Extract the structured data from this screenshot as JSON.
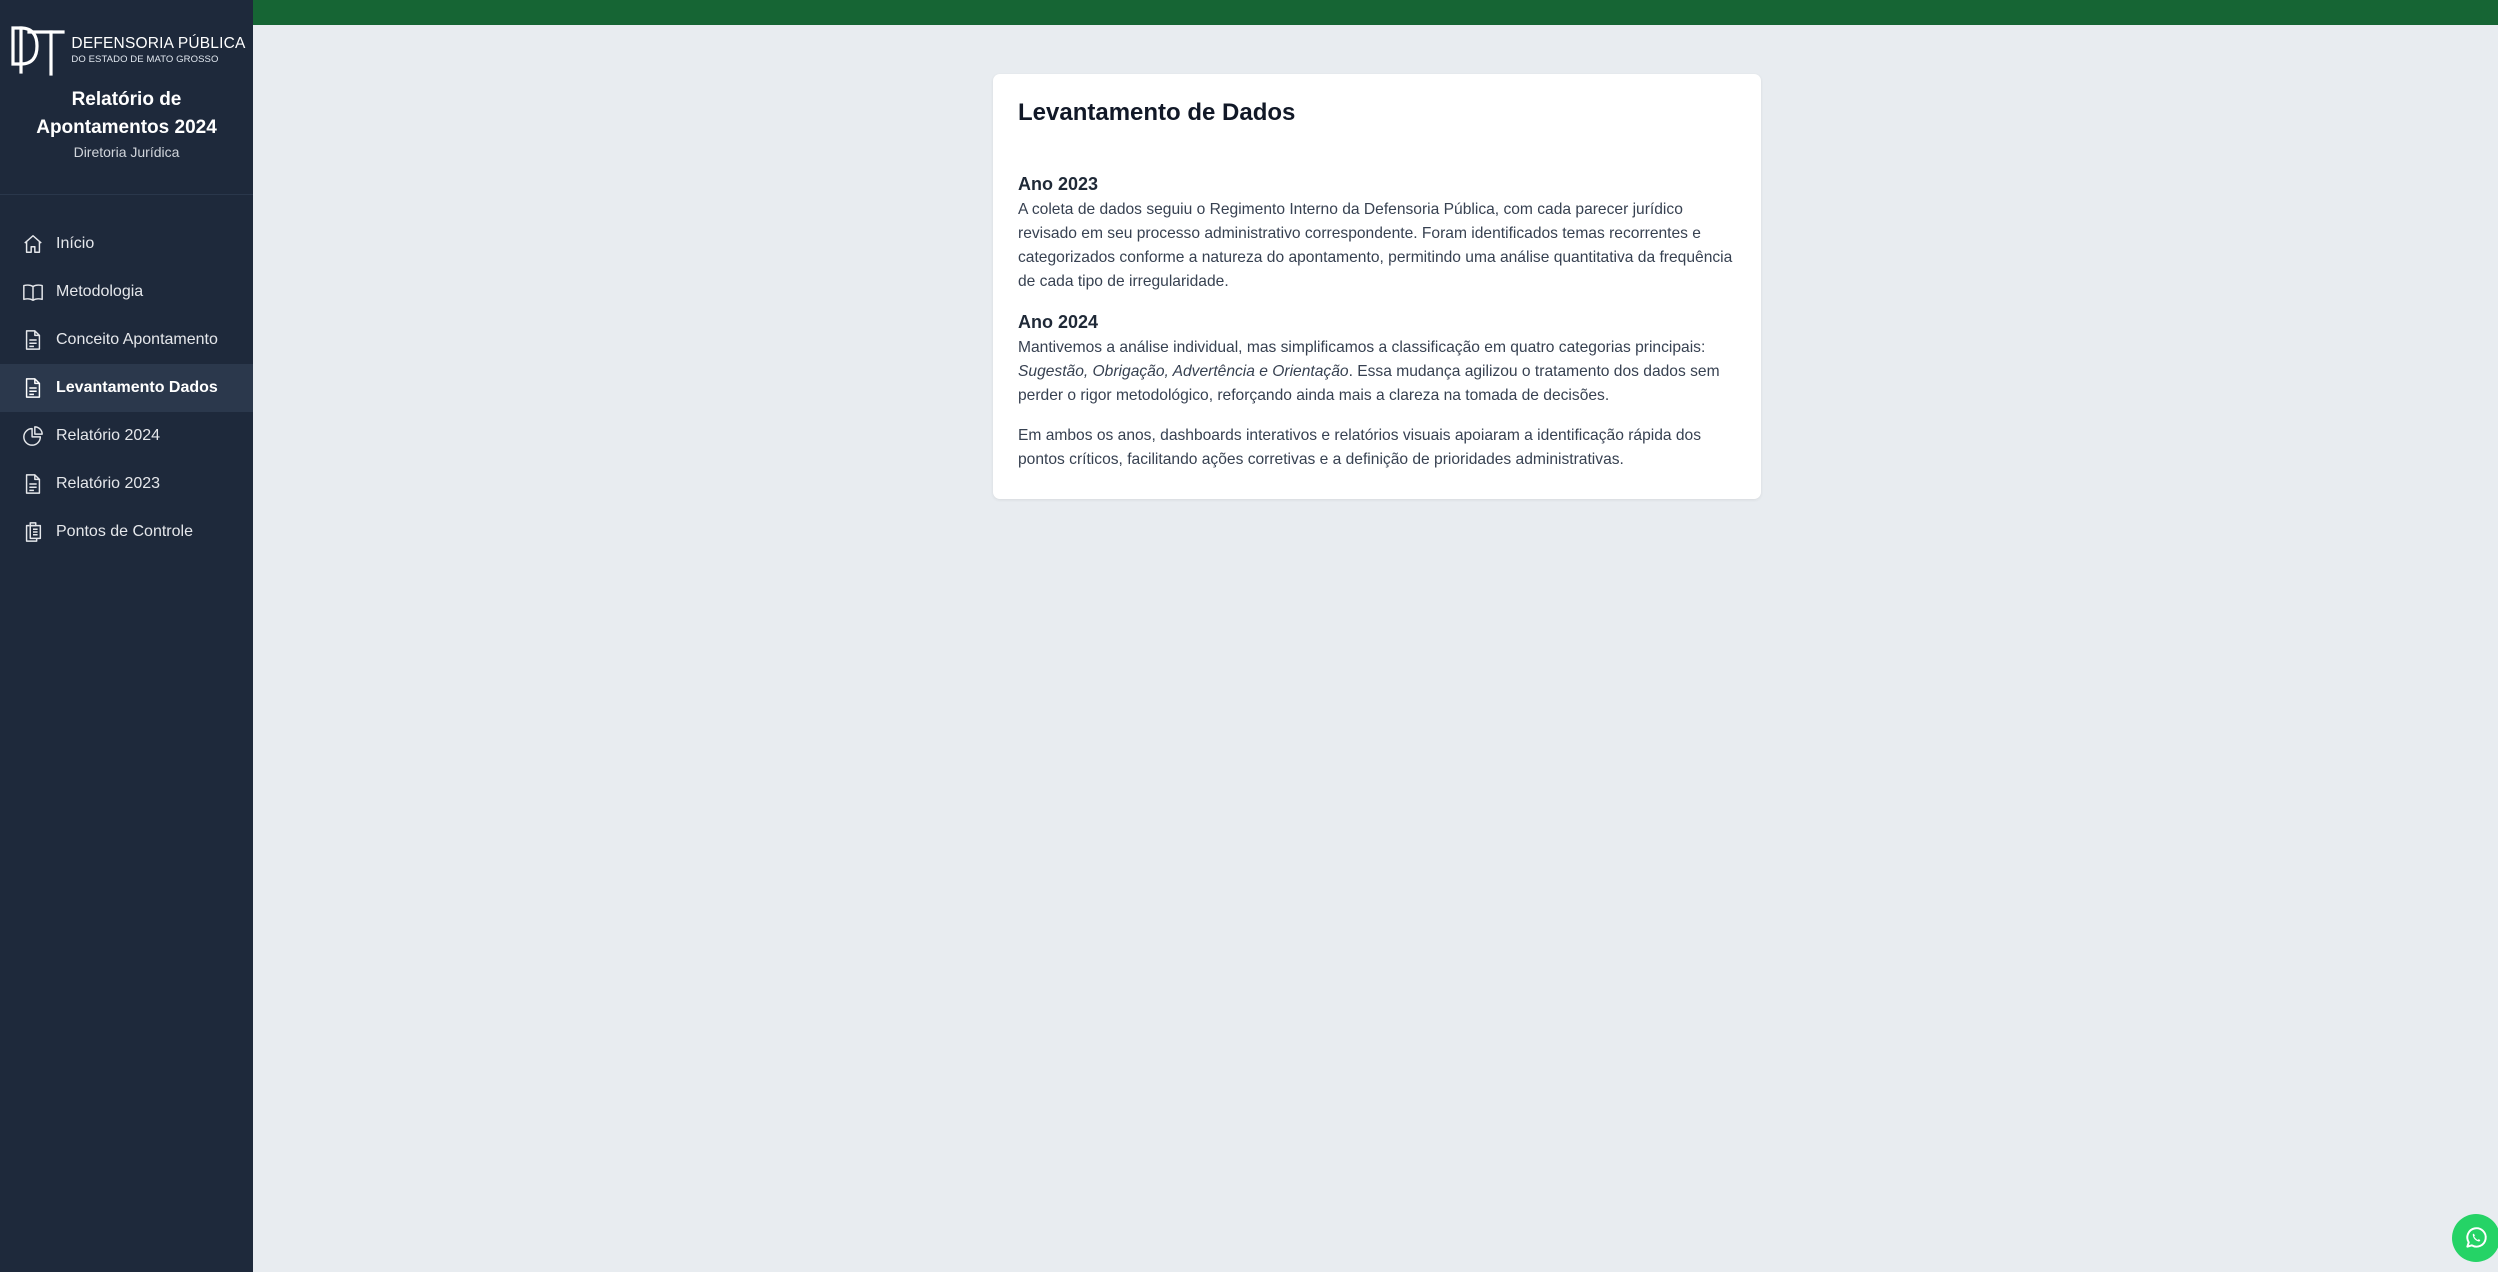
{
  "logo": {
    "line1": "DEFENSORIA PÚBLICA",
    "line2": "DO ESTADO DE MATO GROSSO"
  },
  "brand": {
    "title_line1": "Relatório de",
    "title_line2": "Apontamentos 2024",
    "subtitle": "Diretoria Jurídica"
  },
  "nav": {
    "items": [
      {
        "label": "Início",
        "icon": "home-icon"
      },
      {
        "label": "Metodologia",
        "icon": "book-icon"
      },
      {
        "label": "Conceito Apontamento",
        "icon": "document-icon"
      },
      {
        "label": "Levantamento Dados",
        "icon": "document-icon",
        "active": true
      },
      {
        "label": "Relatório 2024",
        "icon": "pie-chart-icon"
      },
      {
        "label": "Relatório 2023",
        "icon": "document-icon"
      },
      {
        "label": "Pontos de Controle",
        "icon": "clipboard-icon"
      }
    ]
  },
  "colors": {
    "sidebar_bg": "#1e293b",
    "topbar": "#166534",
    "page_bg": "#e8ecf0",
    "whatsapp": "#25d366"
  },
  "content": {
    "title": "Levantamento de Dados",
    "section_2023": {
      "heading": "Ano 2023",
      "text": "A coleta de dados seguiu o Regimento Interno da Defensoria Pública, com cada parecer jurídico revisado em seu processo administrativo correspondente. Foram identificados temas recorrentes e categorizados conforme a natureza do apontamento, permitindo uma análise quantitativa da frequência de cada tipo de irregularidade."
    },
    "section_2024": {
      "heading": "Ano 2024",
      "text_before": "Mantivemos a análise individual, mas simplificamos a classificação em quatro categorias principais: ",
      "text_italic": "Sugestão, Obrigação, Advertência e Orientação",
      "text_after": ". Essa mudança agilizou o tratamento dos dados sem perder o rigor metodológico, reforçando ainda mais a clareza na tomada de decisões."
    },
    "closing": "Em ambos os anos, dashboards interativos e relatórios visuais apoiaram a identificação rápida dos pontos críticos, facilitando ações corretivas e a definição de prioridades administrativas."
  },
  "whatsapp": {
    "icon": "whatsapp-icon"
  }
}
